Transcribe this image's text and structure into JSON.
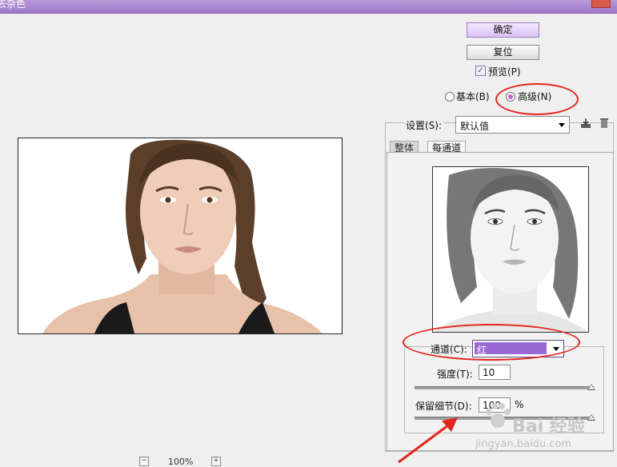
{
  "window": {
    "title": "去杂色"
  },
  "buttons": {
    "ok": "确定",
    "reset": "复位"
  },
  "preview": {
    "label": "预览(P)",
    "checked": true
  },
  "mode": {
    "basic_label": "基本(B)",
    "advanced_label": "高级(N)",
    "selected": "advanced"
  },
  "settings": {
    "label": "设置(S):",
    "value": "默认值"
  },
  "tabs": [
    {
      "label": "整体",
      "active": false
    },
    {
      "label": "每通道",
      "active": true
    }
  ],
  "channel": {
    "label": "通道(C):",
    "value": "红",
    "color": "#9b69d6"
  },
  "strength": {
    "label": "强度(T):",
    "value": "10",
    "slider_fraction": 1.0
  },
  "preserve": {
    "label": "保留细节(D):",
    "value": "100",
    "unit": "%",
    "slider_fraction": 1.0
  },
  "zoom": {
    "value": "100%",
    "minus": "−",
    "plus": "+"
  },
  "watermark": {
    "line1": "Bai 经验",
    "line2": "jingyan.baidu.com"
  },
  "colors": {
    "title_bar": "#a683cf",
    "annotation": "#e3241c",
    "accent": "#c65fd6"
  },
  "icons": [
    "save-preset-icon",
    "delete-preset-icon",
    "checkbox-check-icon",
    "dropdown-arrow-icon",
    "zoom-out-icon",
    "zoom-in-icon",
    "arrow-annotation"
  ]
}
